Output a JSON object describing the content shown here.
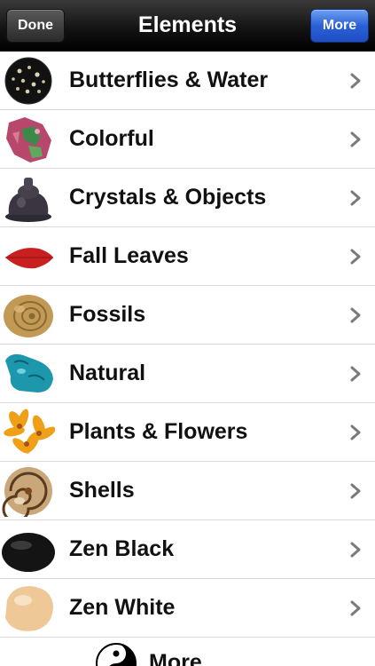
{
  "navbar": {
    "title": "Elements",
    "done_label": "Done",
    "more_label": "More"
  },
  "list": {
    "items": [
      {
        "label": "Butterflies & Water",
        "icon": "black-stone-with-dots"
      },
      {
        "label": "Colorful",
        "icon": "colorful-mineral"
      },
      {
        "label": "Crystals & Objects",
        "icon": "dark-figurine"
      },
      {
        "label": "Fall Leaves",
        "icon": "red-leaf"
      },
      {
        "label": "Fossils",
        "icon": "ammonite-fossil"
      },
      {
        "label": "Natural",
        "icon": "turquoise-stone"
      },
      {
        "label": "Plants & Flowers",
        "icon": "yellow-lilies"
      },
      {
        "label": "Shells",
        "icon": "spiral-shell"
      },
      {
        "label": "Zen Black",
        "icon": "black-pebble"
      },
      {
        "label": "Zen White",
        "icon": "white-pebble"
      }
    ]
  },
  "footer": {
    "more_label": "More",
    "icon": "yin-yang"
  },
  "colors": {
    "more_button": "#2a61d8",
    "navbar": "#141414",
    "chevron": "#7a7a7a"
  }
}
